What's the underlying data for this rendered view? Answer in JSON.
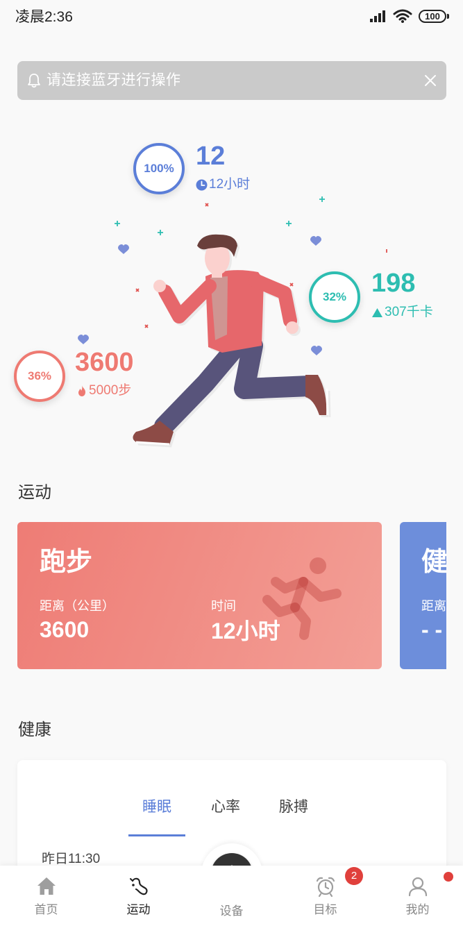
{
  "status_bar": {
    "time": "凌晨2:36",
    "battery": "100",
    "icons": [
      "signal-icon",
      "wifi-icon",
      "battery-icon"
    ]
  },
  "banner": {
    "icon": "bell-icon",
    "text": "请连接蓝牙进行操作",
    "close_icon": "close-icon",
    "background": "#cacaca"
  },
  "hero": {
    "illustration": "running-man",
    "time": {
      "percent": "100%",
      "value": "12",
      "icon": "clock-icon",
      "detail": "12小时",
      "color": "#5b7ed8"
    },
    "calories": {
      "percent": "32%",
      "value": "198",
      "icon": "triangle-up-icon",
      "detail": "307千卡",
      "color": "#2dbdb1"
    },
    "steps": {
      "percent": "36%",
      "value": "3600",
      "icon": "fire-icon",
      "detail": "5000步",
      "color": "#ee7a72"
    }
  },
  "sport": {
    "title": "运动",
    "cards": [
      {
        "title": "跑步",
        "distance_label": "距离（公里）",
        "distance": "3600",
        "time_label": "时间",
        "time": "12小时",
        "icon": "running-icon",
        "color": "#ee7c75"
      },
      {
        "title": "健",
        "distance_label": "距离",
        "distance": "- -",
        "color": "#6d8edb"
      }
    ]
  },
  "health": {
    "title": "健康",
    "tabs": [
      {
        "label": "睡眠",
        "active": true
      },
      {
        "label": "心率",
        "active": false
      },
      {
        "label": "脉搏",
        "active": false
      }
    ],
    "record_time": "昨日11:30",
    "accent": "#5b7ed8"
  },
  "tab_bar": {
    "items": [
      {
        "label": "首页",
        "icon": "home-icon",
        "active": false
      },
      {
        "label": "运动",
        "icon": "sport-icon",
        "active": true
      },
      {
        "label": "设备",
        "icon": "plus-icon",
        "active": false
      },
      {
        "label": "目标",
        "icon": "alarm-clock-icon",
        "active": false,
        "badge": "2"
      },
      {
        "label": "我的",
        "icon": "user-icon",
        "active": false,
        "dot": true
      }
    ],
    "badge_color": "#e0403c"
  }
}
